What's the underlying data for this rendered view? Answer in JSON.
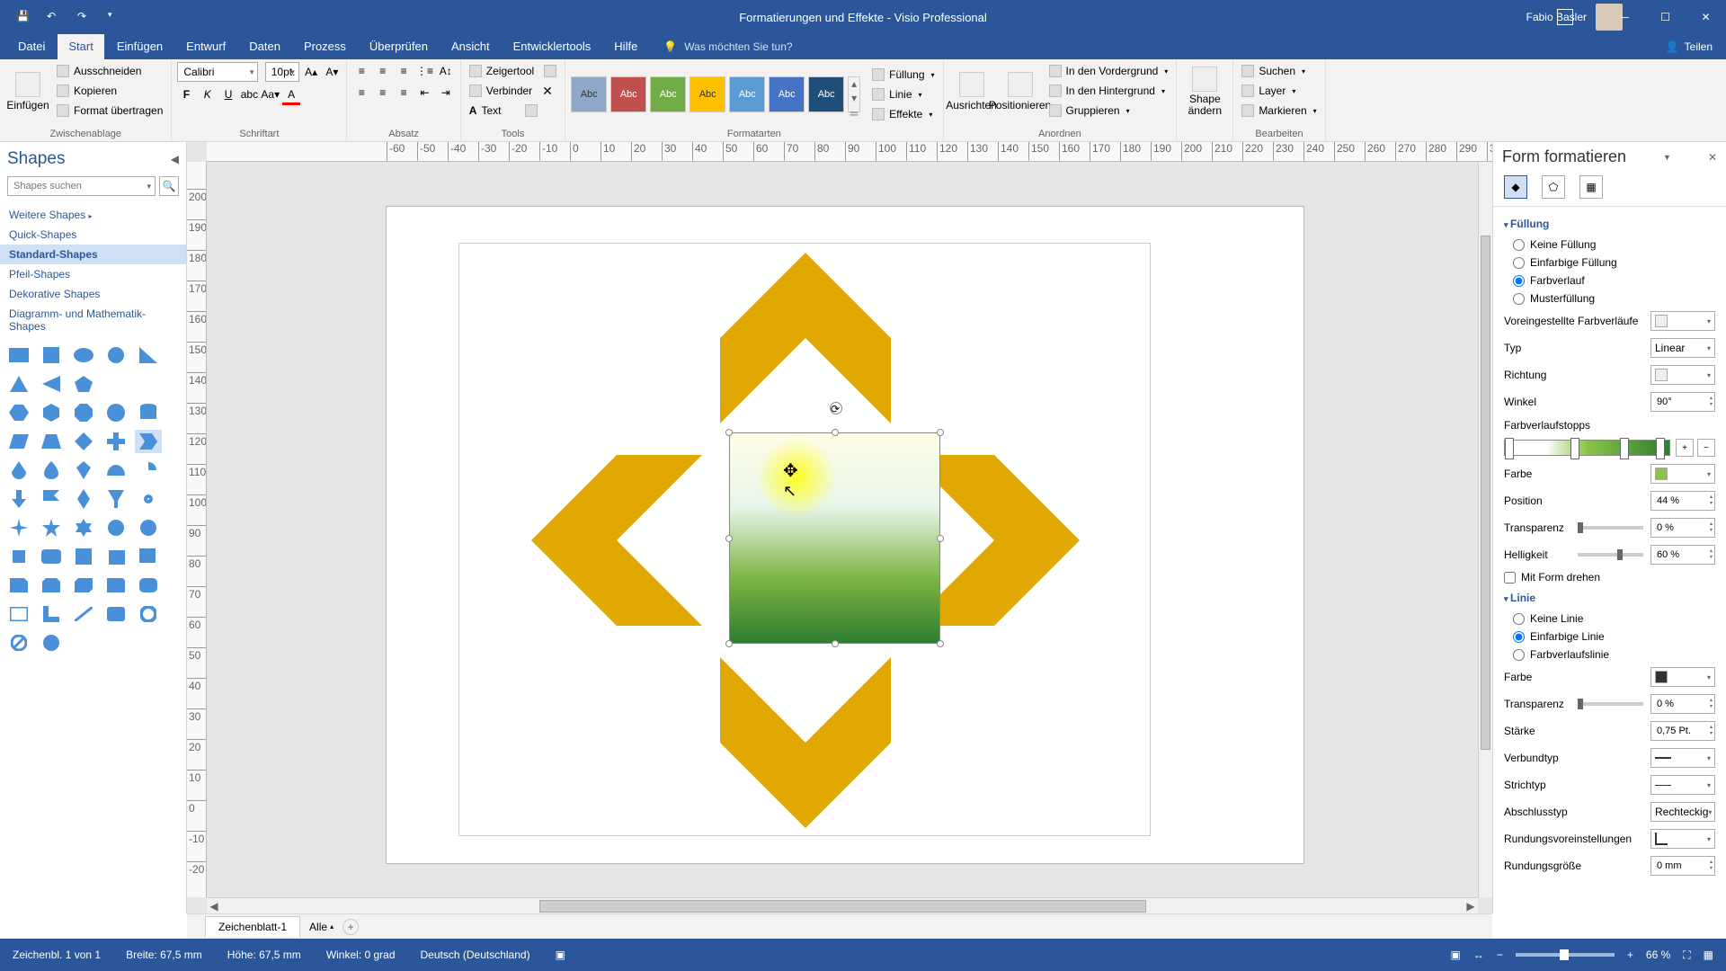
{
  "titlebar": {
    "document": "Formatierungen und Effekte",
    "app": "Visio Professional",
    "title_combined": "Formatierungen und Effekte  -  Visio Professional",
    "user": "Fabio Basler"
  },
  "ribbon_tabs": {
    "file": "Datei",
    "home": "Start",
    "insert": "Einfügen",
    "design": "Entwurf",
    "data": "Daten",
    "process": "Prozess",
    "review": "Überprüfen",
    "view": "Ansicht",
    "developer": "Entwicklertools",
    "help": "Hilfe",
    "tell_me": "Was möchten Sie tun?",
    "share": "Teilen"
  },
  "ribbon": {
    "clipboard": {
      "label": "Zwischenablage",
      "paste": "Einfügen",
      "cut": " Ausschneiden",
      "copy": " Kopieren",
      "format_painter": " Format übertragen"
    },
    "font": {
      "label": "Schriftart",
      "name": "Calibri",
      "size": "10pt."
    },
    "paragraph": {
      "label": "Absatz"
    },
    "tools": {
      "label": "Tools",
      "pointer": " Zeigertool",
      "connector": " Verbinder",
      "text": " Text"
    },
    "shape_styles": {
      "label": "Formatarten",
      "fill": " Füllung",
      "line": " Linie",
      "effects": " Effekte"
    },
    "arrange": {
      "label": "Anordnen",
      "align": "Ausrichten",
      "position": "Positionieren",
      "front": " In den Vordergrund",
      "back": " In den Hintergrund",
      "group": " Gruppieren"
    },
    "change_shape": "Shape ändern",
    "editing": {
      "label": "Bearbeiten",
      "find": " Suchen",
      "layer": " Layer",
      "select": " Markieren"
    }
  },
  "shapes_panel": {
    "title": "Shapes",
    "search_placeholder": "Shapes suchen",
    "cats": {
      "more": "Weitere Shapes",
      "quick": "Quick-Shapes",
      "standard": "Standard-Shapes",
      "arrow": "Pfeil-Shapes",
      "decorative": "Dekorative Shapes",
      "diagram": "Diagramm- und Mathematik-Shapes"
    }
  },
  "tabstrip": {
    "page1": "Zeichenblatt-1",
    "all": "Alle"
  },
  "statusbar": {
    "page": "Zeichenbl. 1 von 1",
    "width": "Breite: 67,5 mm",
    "height": "Höhe: 67,5 mm",
    "angle": "Winkel: 0 grad",
    "lang": "Deutsch (Deutschland)",
    "zoom": "66 %"
  },
  "format_pane": {
    "title": "Form formatieren",
    "fill": {
      "section": "Füllung",
      "none": "Keine Füllung",
      "solid": "Einfarbige Füllung",
      "gradient": "Farbverlauf",
      "pattern": "Musterfüllung",
      "preset": "Voreingestellte Farbverläufe",
      "type": "Typ",
      "type_val": "Linear",
      "direction": "Richtung",
      "angle": "Winkel",
      "angle_val": "90°",
      "stops": "Farbverlaufstopps",
      "color": "Farbe",
      "position": "Position",
      "position_val": "44 %",
      "transparency": "Transparenz",
      "transparency_val": "0 %",
      "brightness": "Helligkeit",
      "brightness_val": "60 %",
      "rotate_with_shape": "Mit Form drehen"
    },
    "line": {
      "section": "Linie",
      "none": "Keine Linie",
      "solid": "Einfarbige Linie",
      "gradient": "Farbverlaufslinie",
      "color": "Farbe",
      "transparency": "Transparenz",
      "transparency_val": "0 %",
      "width": "Stärke",
      "width_val": "0,75 Pt.",
      "compound": "Verbundtyp",
      "dash": "Strichtyp",
      "cap": "Abschlusstyp",
      "cap_val": "Rechteckig",
      "join": "Rundungsvoreinstellungen",
      "rounding": "Rundungsgröße",
      "rounding_val": "0 mm"
    }
  }
}
